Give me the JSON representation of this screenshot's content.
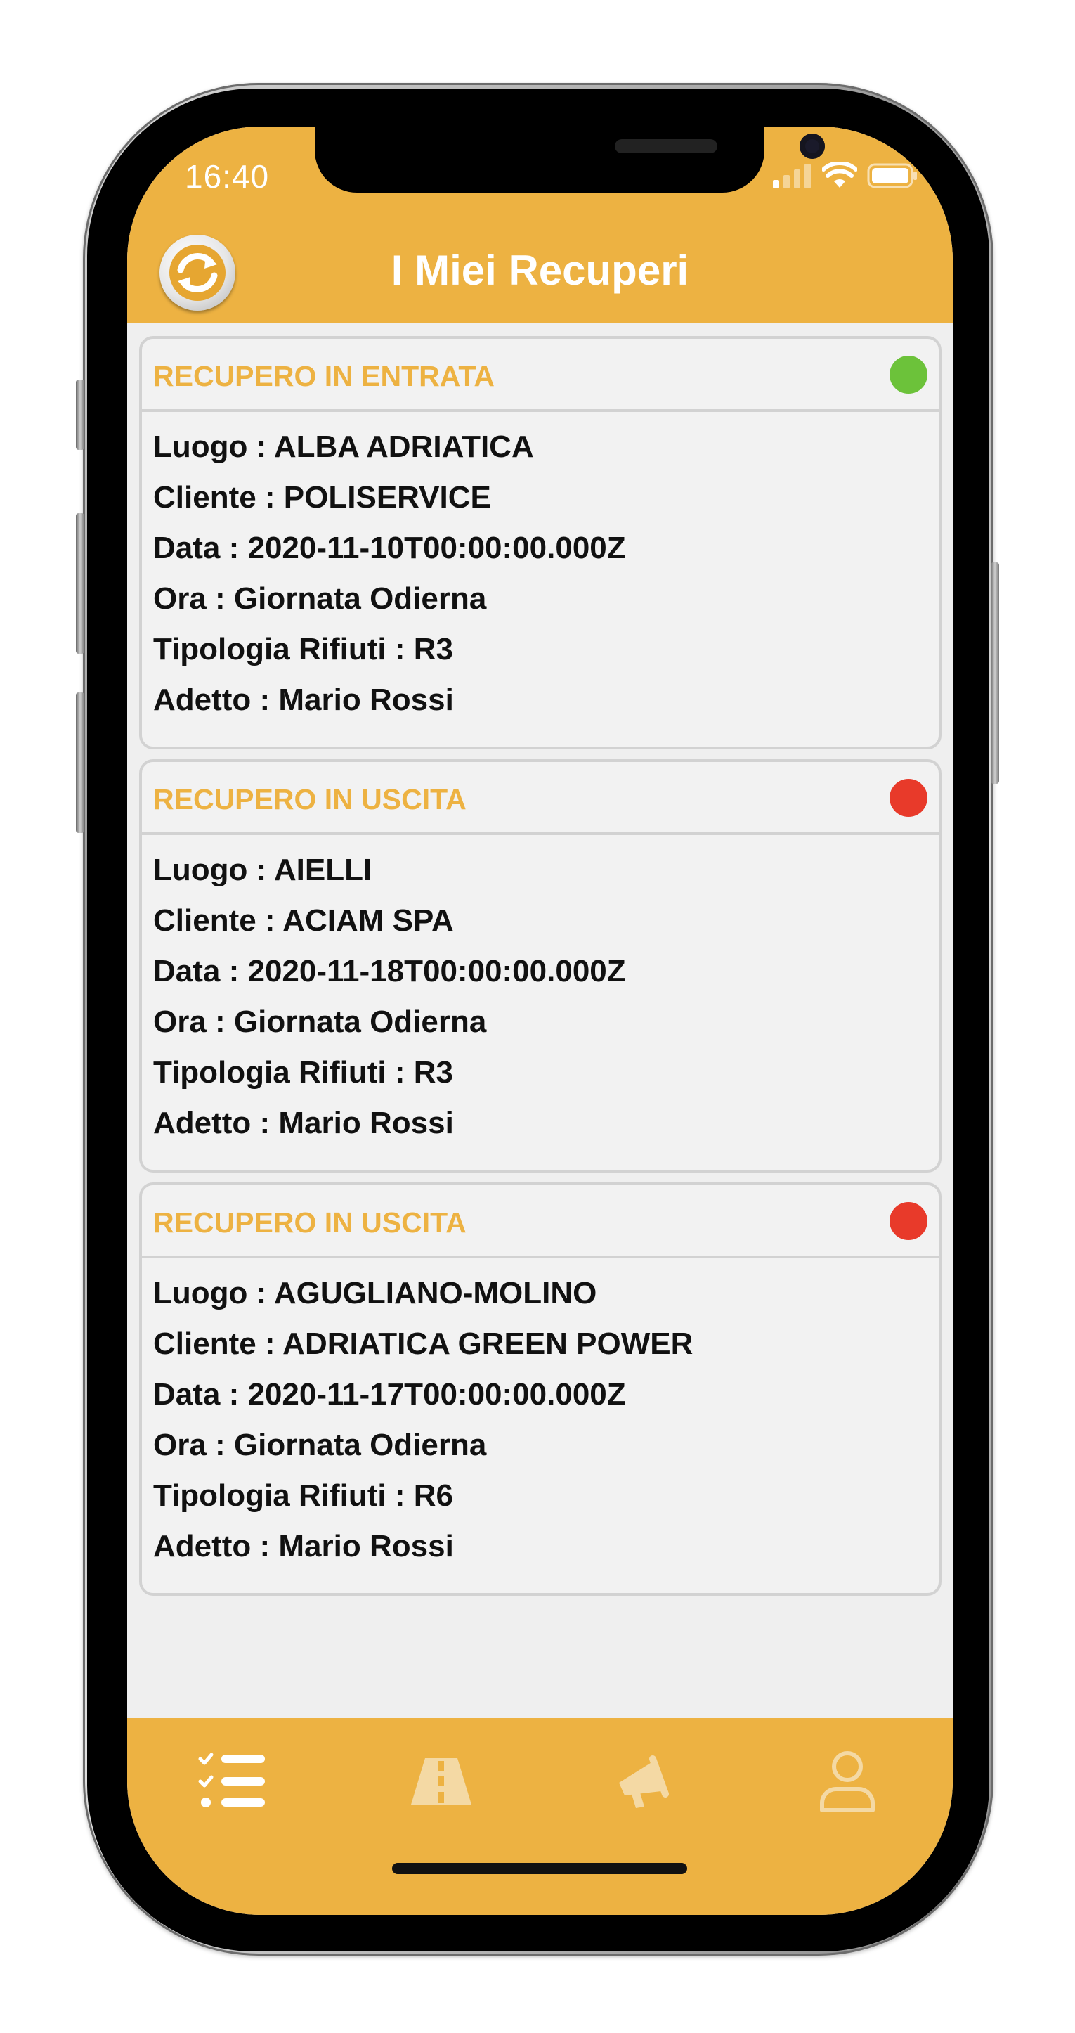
{
  "status_bar": {
    "time": "16:40"
  },
  "header": {
    "title": "I Miei Recuperi",
    "logo_icon": "refresh-logo-icon"
  },
  "colors": {
    "accent": "#edb242",
    "status_green": "#6cc23a",
    "status_red": "#e83a2a"
  },
  "cards": [
    {
      "title": "RECUPERO IN ENTRATA",
      "status_color": "#6cc23a",
      "rows": [
        "Luogo : ALBA ADRIATICA",
        "Cliente : POLISERVICE",
        "Data : 2020-11-10T00:00:00.000Z",
        "Ora : Giornata Odierna",
        "Tipologia Rifiuti : R3",
        "Adetto : Mario Rossi"
      ]
    },
    {
      "title": "RECUPERO IN USCITA",
      "status_color": "#e83a2a",
      "rows": [
        "Luogo : AIELLI",
        "Cliente : ACIAM SPA",
        "Data : 2020-11-18T00:00:00.000Z",
        "Ora : Giornata Odierna",
        "Tipologia Rifiuti : R3",
        "Adetto : Mario Rossi"
      ]
    },
    {
      "title": "RECUPERO IN USCITA",
      "status_color": "#e83a2a",
      "rows": [
        "Luogo : AGUGLIANO-MOLINO",
        "Cliente : ADRIATICA GREEN POWER",
        "Data : 2020-11-17T00:00:00.000Z",
        "Ora : Giornata Odierna",
        "Tipologia Rifiuti : R6",
        "Adetto : Mario Rossi"
      ]
    }
  ],
  "tabbar": {
    "items": [
      {
        "icon": "checklist-icon",
        "active": true
      },
      {
        "icon": "road-icon",
        "active": false
      },
      {
        "icon": "megaphone-icon",
        "active": false
      },
      {
        "icon": "user-icon",
        "active": false
      }
    ]
  }
}
